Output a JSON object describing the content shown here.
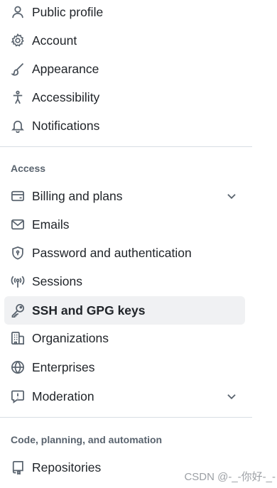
{
  "nav_top": [
    {
      "label": "Public profile",
      "icon": "person-icon"
    },
    {
      "label": "Account",
      "icon": "gear-icon"
    },
    {
      "label": "Appearance",
      "icon": "paintbrush-icon"
    },
    {
      "label": "Accessibility",
      "icon": "accessibility-icon"
    },
    {
      "label": "Notifications",
      "icon": "bell-icon"
    }
  ],
  "sections": {
    "access": "Access",
    "code": "Code, planning, and automation"
  },
  "nav_access": [
    {
      "label": "Billing and plans",
      "icon": "credit-card-icon",
      "expandable": true
    },
    {
      "label": "Emails",
      "icon": "mail-icon"
    },
    {
      "label": "Password and authentication",
      "icon": "shield-lock-icon"
    },
    {
      "label": "Sessions",
      "icon": "broadcast-icon"
    },
    {
      "label": "SSH and GPG keys",
      "icon": "key-icon",
      "selected": true
    },
    {
      "label": "Organizations",
      "icon": "organization-icon"
    },
    {
      "label": "Enterprises",
      "icon": "globe-icon"
    },
    {
      "label": "Moderation",
      "icon": "report-icon",
      "expandable": true
    }
  ],
  "nav_code": [
    {
      "label": "Repositories",
      "icon": "repo-icon"
    }
  ],
  "watermark": "CSDN @-_-你好-_-"
}
